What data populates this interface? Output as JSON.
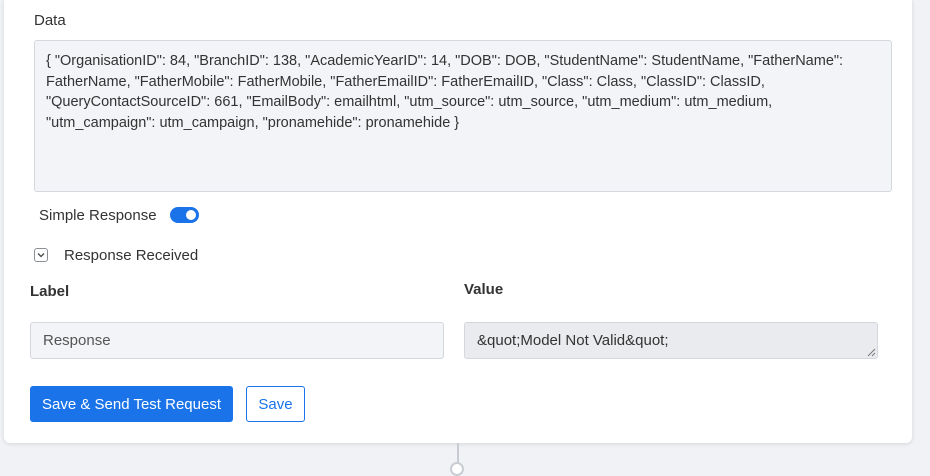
{
  "data_field": {
    "label": "Data",
    "value": "{ \"OrganisationID\": 84, \"BranchID\": 138, \"AcademicYearID\": 14, \"DOB\": DOB, \"StudentName\": StudentName, \"FatherName\": FatherName, \"FatherMobile\": FatherMobile, \"FatherEmailID\": FatherEmailID, \"Class\": Class, \"ClassID\": ClassID, \"QueryContactSourceID\": 661, \"EmailBody\": emailhtml, \"utm_source\": utm_source, \"utm_medium\": utm_medium, \"utm_campaign\": utm_campaign, \"pronamehide\": pronamehide }"
  },
  "simple_response": {
    "label": "Simple Response",
    "enabled": true
  },
  "response_received": {
    "label": "Response Received",
    "expanded": true
  },
  "mapping": {
    "label_header": "Label",
    "value_header": "Value",
    "label_value": "Response",
    "value_value": "&quot;Model Not Valid&quot;"
  },
  "actions": {
    "save_send_label": "Save & Send Test Request",
    "save_label": "Save"
  },
  "colors": {
    "accent": "#1a73e8",
    "field_bg": "#f2f4f7"
  }
}
